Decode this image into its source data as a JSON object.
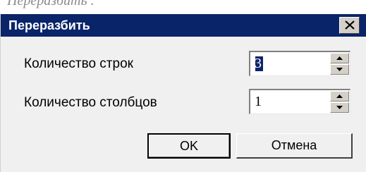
{
  "header_caption": "Переразбить .",
  "dialog": {
    "title": "Переразбить",
    "close_icon": "close-icon",
    "rows_label": "Количество строк",
    "rows_value": "3",
    "cols_label": "Количество столбцов",
    "cols_value": "1",
    "ok_label": "OK",
    "cancel_label": "Отмена"
  }
}
